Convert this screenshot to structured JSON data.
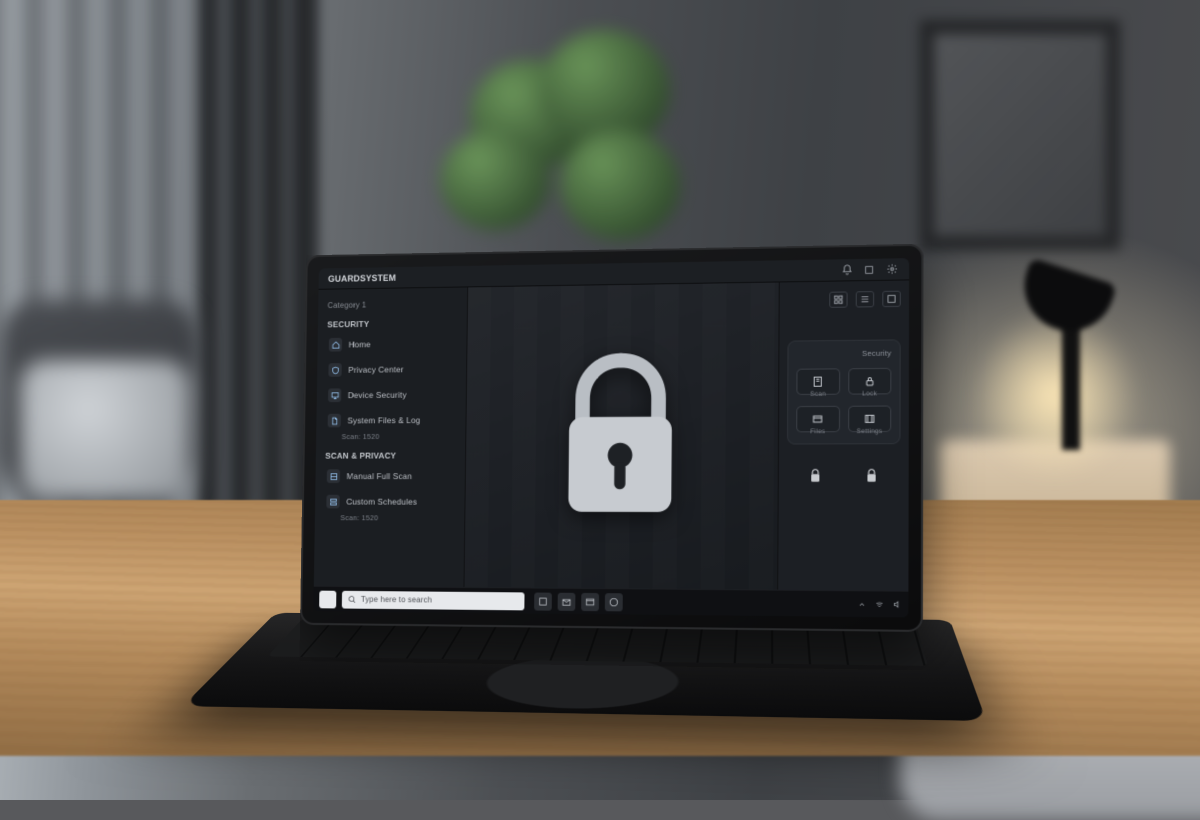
{
  "titlebar": {
    "title": "GUARDSYSTEM"
  },
  "sidebar": {
    "category_label": "Category 1",
    "section_a": "SECURITY",
    "section_a_items": [
      {
        "label": "Home"
      },
      {
        "label": "Privacy Center"
      },
      {
        "label": "Device Security"
      },
      {
        "label": "System Files & Log",
        "sub": "Scan: 1520"
      }
    ],
    "section_b": "SCAN & PRIVACY",
    "section_b_items": [
      {
        "label": "Manual Full Scan"
      },
      {
        "label": "Custom Schedules",
        "sub": "Scan: 1520"
      }
    ]
  },
  "right": {
    "card_title": "Security",
    "chips": [
      "Scan",
      "Lock",
      "Files",
      "Settings"
    ]
  },
  "taskbar": {
    "search_placeholder": "Type here to search"
  }
}
